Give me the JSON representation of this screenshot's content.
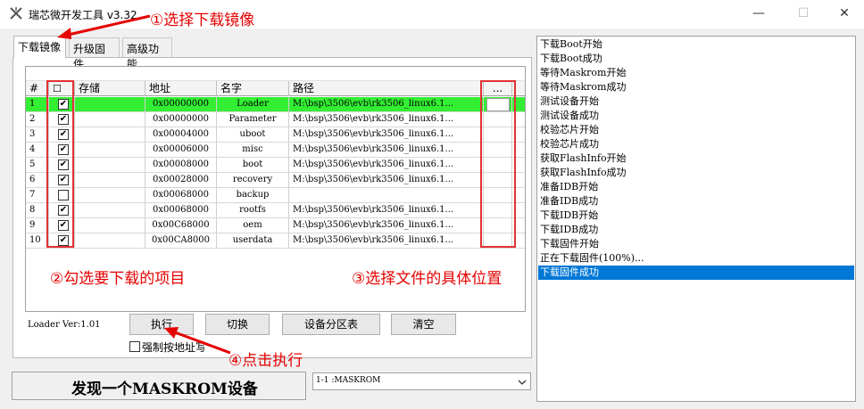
{
  "window": {
    "title": "瑞芯微开发工具 v3.32",
    "minimize": "—",
    "maximize": "☐",
    "close": "✕"
  },
  "tabs": [
    {
      "label": "下载镜像",
      "active": true
    },
    {
      "label": "升级固件",
      "active": false
    },
    {
      "label": "高级功能",
      "active": false
    }
  ],
  "table": {
    "headers": {
      "num": "#",
      "check": "☐",
      "storage": "存储",
      "address": "地址",
      "name": "名字",
      "path": "路径",
      "browse": "..."
    },
    "rows": [
      {
        "num": "1",
        "checked": true,
        "address": "0x00000000",
        "name": "Loader",
        "path": "M:\\bsp\\3506\\evb\\rk3506_linux6.1...",
        "selected": true
      },
      {
        "num": "2",
        "checked": true,
        "address": "0x00000000",
        "name": "Parameter",
        "path": "M:\\bsp\\3506\\evb\\rk3506_linux6.1..."
      },
      {
        "num": "3",
        "checked": true,
        "address": "0x00004000",
        "name": "uboot",
        "path": "M:\\bsp\\3506\\evb\\rk3506_linux6.1..."
      },
      {
        "num": "4",
        "checked": true,
        "address": "0x00006000",
        "name": "misc",
        "path": "M:\\bsp\\3506\\evb\\rk3506_linux6.1..."
      },
      {
        "num": "5",
        "checked": true,
        "address": "0x00008000",
        "name": "boot",
        "path": "M:\\bsp\\3506\\evb\\rk3506_linux6.1..."
      },
      {
        "num": "6",
        "checked": true,
        "address": "0x00028000",
        "name": "recovery",
        "path": "M:\\bsp\\3506\\evb\\rk3506_linux6.1..."
      },
      {
        "num": "7",
        "checked": false,
        "address": "0x00068000",
        "name": "backup",
        "path": ""
      },
      {
        "num": "8",
        "checked": true,
        "address": "0x00068000",
        "name": "rootfs",
        "path": "M:\\bsp\\3506\\evb\\rk3506_linux6.1..."
      },
      {
        "num": "9",
        "checked": true,
        "address": "0x00C68000",
        "name": "oem",
        "path": "M:\\bsp\\3506\\evb\\rk3506_linux6.1..."
      },
      {
        "num": "10",
        "checked": true,
        "address": "0x00CA8000",
        "name": "userdata",
        "path": "M:\\bsp\\3506\\evb\\rk3506_linux6.1..."
      }
    ]
  },
  "loader_version": "Loader Ver:1.01",
  "buttons": {
    "run": "执行",
    "switch": "切换",
    "partition": "设备分区表",
    "clear": "清空"
  },
  "force_write": {
    "label": "强制按地址写",
    "checked": false
  },
  "status": "发现一个MASKROM设备",
  "device": {
    "value": "1-1 :MASKROM"
  },
  "log": [
    "下载Boot开始",
    "下载Boot成功",
    "等待Maskrom开始",
    "等待Maskrom成功",
    "测试设备开始",
    "测试设备成功",
    "校验芯片开始",
    "校验芯片成功",
    "获取FlashInfo开始",
    "获取FlashInfo成功",
    "准备IDB开始",
    "准备IDB成功",
    "下载IDB开始",
    "下载IDB成功",
    "下载固件开始",
    "正在下载固件(100%)...",
    "下载固件成功"
  ],
  "annotations": {
    "step1": "①选择下载镜像",
    "step2": "②勾选要下载的项目",
    "step3": "③选择文件的具体位置",
    "step4": "④点击执行"
  },
  "colors": {
    "selected_row": "#33ee33",
    "log_selected": "#0078d7",
    "annotation": "#e60000"
  }
}
